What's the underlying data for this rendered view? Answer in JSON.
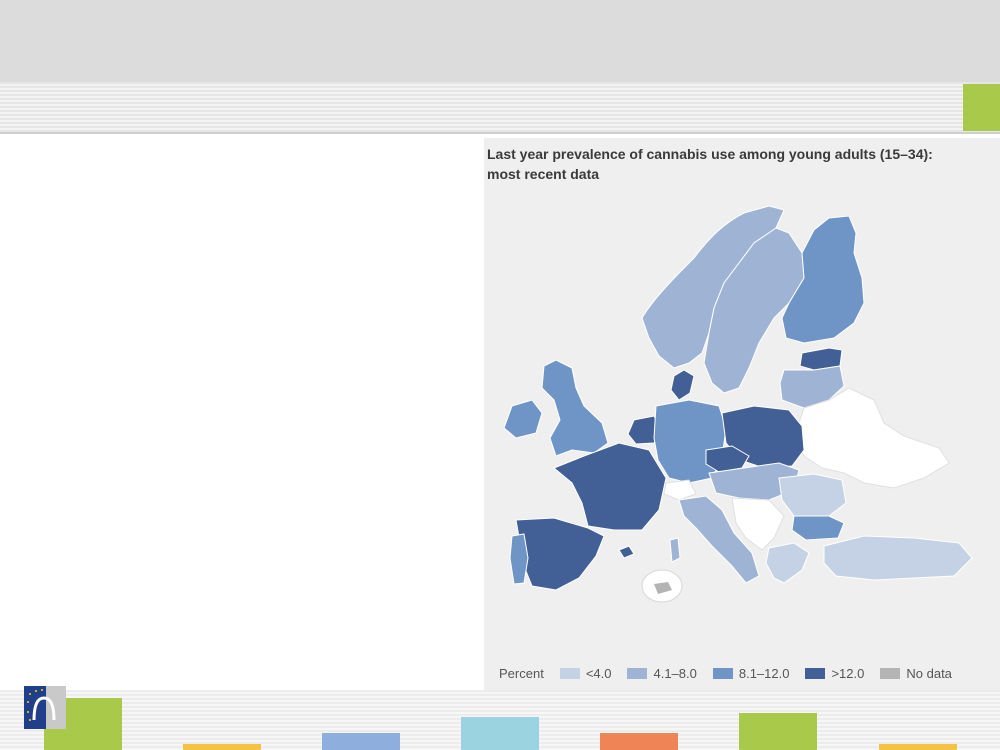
{
  "map": {
    "title_line1": "Last year prevalence of cannabis use among young adults (15–34):",
    "title_line2": "most recent data",
    "legend": {
      "label": "Percent",
      "items": [
        {
          "label": "<4.0",
          "color": "#c5d1e4"
        },
        {
          "label": "4.1–8.0",
          "color": "#9fb3d4"
        },
        {
          "label": "8.1–12.0",
          "color": "#6e95c6"
        },
        {
          "label": ">12.0",
          "color": "#426096"
        },
        {
          "label": "No data",
          "color": "#b4b4b4"
        }
      ]
    }
  },
  "colors": {
    "header_band": "#dcdcdc",
    "accent_green": "#a9c94a",
    "bottom_bars": [
      "#a9c94a",
      "#f5c343",
      "#8eaedd",
      "#9bd3e0",
      "#ef8456",
      "#a9c94a",
      "#f5c343"
    ]
  },
  "logo": {
    "icon": "emcdda-logo"
  }
}
